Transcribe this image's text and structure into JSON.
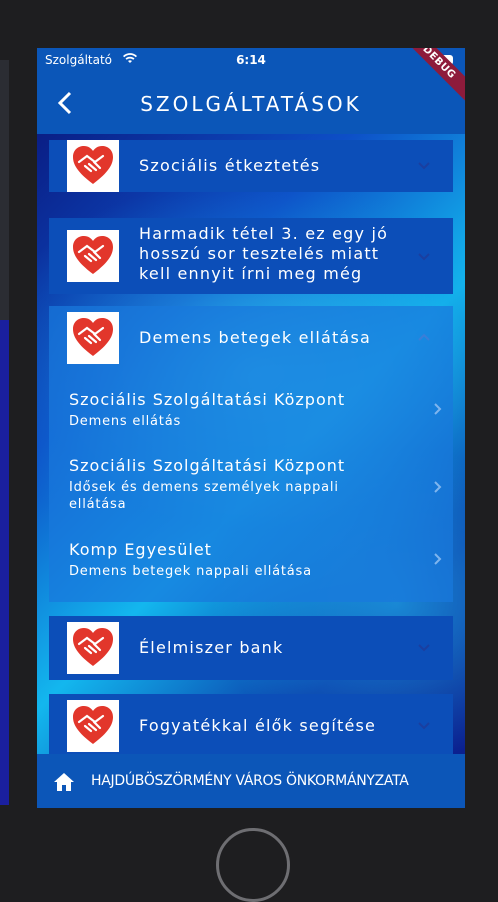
{
  "status": {
    "carrier": "Szolgáltató",
    "time": "6:14",
    "debug_badge": "DEBUG"
  },
  "appbar": {
    "title": "SZOLGÁLTATÁSOK",
    "back_icon": "chevron-left-icon"
  },
  "services": [
    {
      "title": "Szociális étkeztetés",
      "icon": "heart-handshake-icon",
      "expanded": false
    },
    {
      "title": "Harmadik tétel 3. ez egy jó hosszú sor tesztelés miatt kell ennyit írni meg még",
      "icon": "heart-handshake-icon",
      "expanded": false
    },
    {
      "title": "Demens betegek ellátása",
      "icon": "heart-handshake-icon",
      "expanded": true,
      "items": [
        {
          "name": "Szociális Szolgáltatási Központ",
          "desc": "Demens ellátás"
        },
        {
          "name": "Szociális Szolgáltatási Központ",
          "desc": "Idősek és demens személyek nappali ellátása"
        },
        {
          "name": "Komp Egyesület",
          "desc": "Demens betegek nappali ellátása"
        }
      ]
    },
    {
      "title": "Élelmiszer bank",
      "icon": "heart-handshake-icon",
      "expanded": false
    },
    {
      "title": "Fogyatékkal élők segítése",
      "icon": "heart-handshake-icon",
      "expanded": false
    }
  ],
  "footer": {
    "text": "HAJDÚBÖSZÖRMÉNY VÁROS ÖNKORMÁNYZATA",
    "icon": "home-icon"
  },
  "colors": {
    "primary": "#0c4eb8",
    "icon_red": "#e2362b"
  }
}
